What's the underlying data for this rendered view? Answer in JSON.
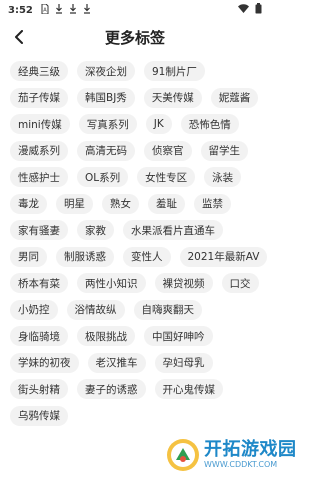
{
  "status": {
    "time": "3:52",
    "icons": [
      "sim-card-icon",
      "download-icon",
      "download-icon",
      "download-icon"
    ],
    "right_icons": [
      "wifi-icon",
      "battery-icon"
    ]
  },
  "header": {
    "title": "更多标签",
    "back_icon": "back-arrow-icon"
  },
  "tag_rows": [
    [
      "经典三级",
      "深夜企划",
      "91制片厂"
    ],
    [
      "茄子传媒",
      "韩国BJ秀",
      "天美传媒",
      "妮蔻酱"
    ],
    [
      "mini传媒",
      "写真系列",
      "JK",
      "恐怖色情"
    ],
    [
      "漫威系列",
      "高清无码",
      "侦察官",
      "留学生"
    ],
    [
      "性感护士",
      "OL系列",
      "女性专区",
      "泳装"
    ],
    [
      "毒龙",
      "明星",
      "熟女",
      "羞耻",
      "监禁"
    ],
    [
      "家有骚妻",
      "家教",
      "水果派看片直通车"
    ],
    [
      "男同",
      "制服诱惑",
      "变性人",
      "2021年最新AV"
    ],
    [
      "桥本有菜",
      "两性小知识",
      "裸贷视频",
      "口交"
    ],
    [
      "小奶控",
      "浴情故纵",
      "自嗨爽翻天"
    ],
    [
      "身临骑境",
      "极限挑战",
      "中国好呻吟"
    ],
    [
      "学妹的初夜",
      "老汉推车",
      "孕妇母乳"
    ],
    [
      "街头射精",
      "妻子的诱惑",
      "开心鬼传媒"
    ],
    [
      "乌鸦传媒"
    ]
  ],
  "watermark": {
    "name": "开拓游戏园",
    "url": "WWW.CDDKT.COM"
  }
}
